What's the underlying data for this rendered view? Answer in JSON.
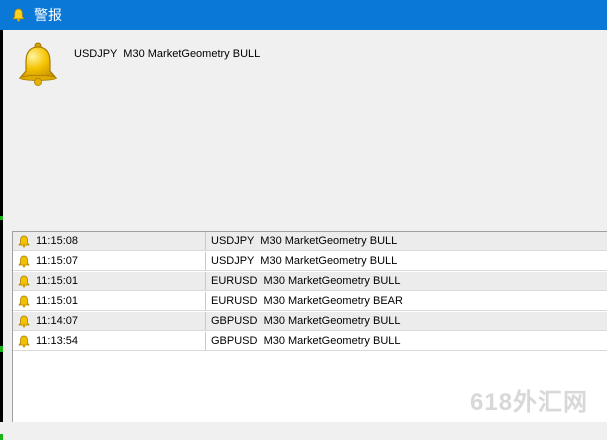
{
  "window": {
    "title": "警报"
  },
  "alert": {
    "message": "USDJPY  M30 MarketGeometry BULL"
  },
  "list": {
    "rows": [
      {
        "time": "11:15:08",
        "message": "USDJPY  M30 MarketGeometry BULL"
      },
      {
        "time": "11:15:07",
        "message": "USDJPY  M30 MarketGeometry BULL"
      },
      {
        "time": "11:15:01",
        "message": "EURUSD  M30 MarketGeometry BULL"
      },
      {
        "time": "11:15:01",
        "message": "EURUSD  M30 MarketGeometry BEAR"
      },
      {
        "time": "11:14:07",
        "message": "GBPUSD  M30 MarketGeometry BULL"
      },
      {
        "time": "11:13:54",
        "message": "GBPUSD  M30 MarketGeometry BULL"
      }
    ]
  },
  "watermark": {
    "text": "618外汇网"
  },
  "colors": {
    "titlebar": "#0a78d7",
    "bell": "#f2c200"
  },
  "icons": {
    "title": "bell-icon",
    "alert": "bell-icon",
    "row": "bell-icon"
  }
}
